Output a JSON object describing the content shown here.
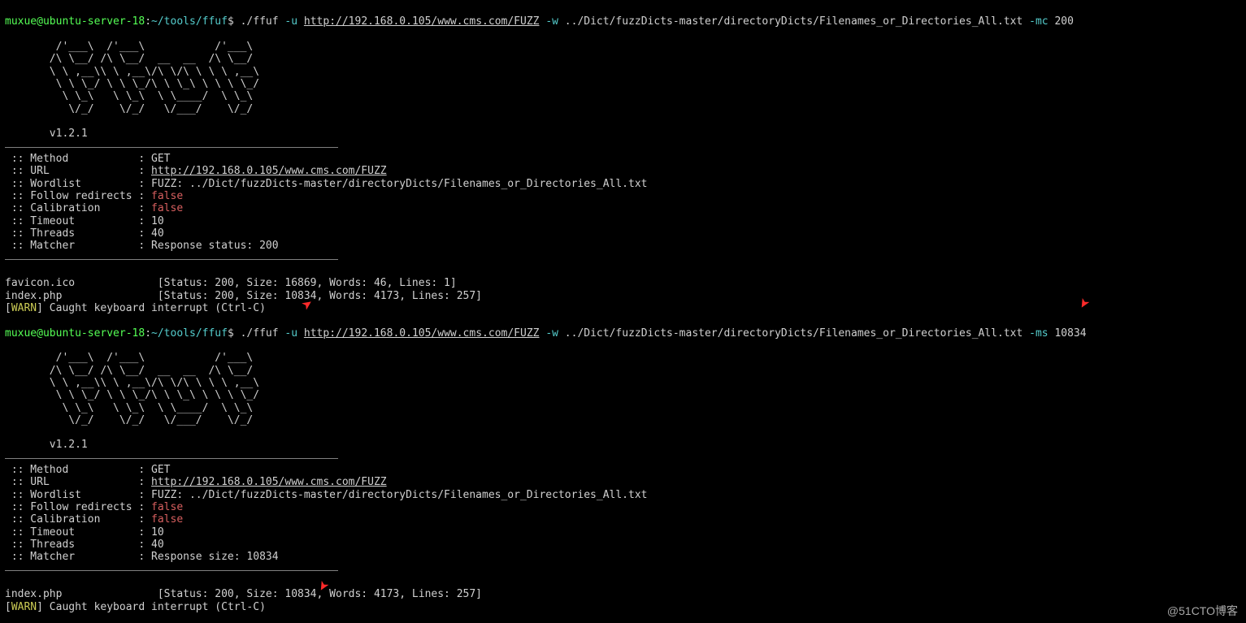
{
  "prompt": {
    "user": "muxue",
    "host": "ubuntu-server-18",
    "cwd": "~/tools/ffuf",
    "sep": "$"
  },
  "cmd1": {
    "bin": "./ffuf",
    "flag_u": "-u",
    "url": "http://192.168.0.105/www.cms.com/FUZZ",
    "flag_w": "-w",
    "wordlist": "../Dict/fuzzDicts-master/directoryDicts/Filenames_or_Directories_All.txt",
    "flag_extra": "-mc",
    "extra_val": "200"
  },
  "cmd2": {
    "bin": "./ffuf",
    "flag_u": "-u",
    "url": "http://192.168.0.105/www.cms.com/FUZZ",
    "flag_w": "-w",
    "wordlist": "../Dict/fuzzDicts-master/directoryDicts/Filenames_or_Directories_All.txt",
    "flag_extra": "-ms",
    "extra_val": "10834"
  },
  "ascii": {
    "l1": "        /'___\\  /'___\\           /'___\\       ",
    "l2": "       /\\ \\__/ /\\ \\__/  __  __  /\\ \\__/       ",
    "l3": "       \\ \\ ,__\\\\ \\ ,__\\/\\ \\/\\ \\ \\ \\ ,__\\      ",
    "l4": "        \\ \\ \\_/ \\ \\ \\_/\\ \\ \\_\\ \\ \\ \\ \\_/      ",
    "l5": "         \\ \\_\\   \\ \\_\\  \\ \\____/  \\ \\_\\       ",
    "l6": "          \\/_/    \\/_/   \\/___/    \\/_/       ",
    "version": "       v1.2.1"
  },
  "config1": {
    "method_k": " :: Method           :",
    "method_v": " GET",
    "url_k": " :: URL              :",
    "url_v": " http://192.168.0.105/www.cms.com/FUZZ",
    "wl_k": " :: Wordlist         :",
    "wl_v": " FUZZ: ../Dict/fuzzDicts-master/directoryDicts/Filenames_or_Directories_All.txt",
    "fr_k": " :: Follow redirects :",
    "fr_v": " false",
    "cal_k": " :: Calibration      :",
    "cal_v": " false",
    "to_k": " :: Timeout          :",
    "to_v": " 10",
    "th_k": " :: Threads          :",
    "th_v": " 40",
    "ma_k": " :: Matcher          :",
    "ma_v": " Response status: 200"
  },
  "config2": {
    "method_k": " :: Method           :",
    "method_v": " GET",
    "url_k": " :: URL              :",
    "url_v": " http://192.168.0.105/www.cms.com/FUZZ",
    "wl_k": " :: Wordlist         :",
    "wl_v": " FUZZ: ../Dict/fuzzDicts-master/directoryDicts/Filenames_or_Directories_All.txt",
    "fr_k": " :: Follow redirects :",
    "fr_v": " false",
    "cal_k": " :: Calibration      :",
    "cal_v": " false",
    "to_k": " :: Timeout          :",
    "to_v": " 10",
    "th_k": " :: Threads          :",
    "th_v": " 40",
    "ma_k": " :: Matcher          :",
    "ma_v": " Response size: 10834"
  },
  "results1": {
    "r1_name": "favicon.ico             ",
    "r1_stat": "[Status: 200, Size: 16869, Words: 46, Lines: 1]",
    "r2_name": "index.php               ",
    "r2_stat": "[Status: 200, Size: 10834, Words: 4173, Lines: 257]"
  },
  "results2": {
    "r1_name": "index.php               ",
    "r1_stat": "[Status: 200, Size: 10834, Words: 4173, Lines: 257]"
  },
  "warn": {
    "open": "[",
    "tag": "WARN",
    "close": "] Caught keyboard interrupt (Ctrl-C)"
  },
  "watermark": "@51CTO博客"
}
